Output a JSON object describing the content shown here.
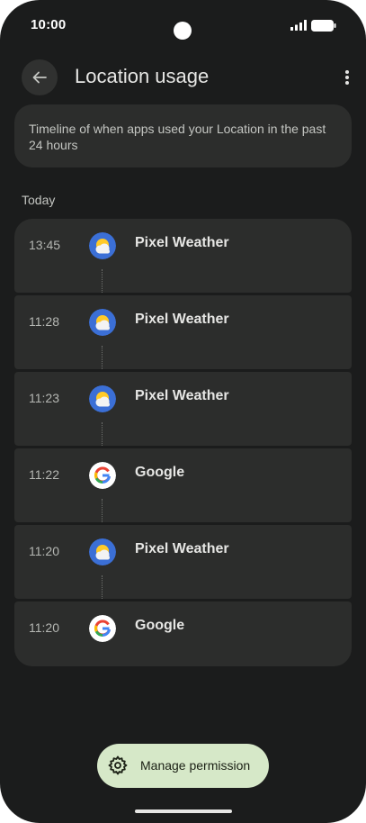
{
  "status_bar": {
    "time": "10:00"
  },
  "app_bar": {
    "title": "Location usage"
  },
  "info": {
    "text": "Timeline of when apps used your Location in the past 24 hours"
  },
  "section": {
    "label": "Today"
  },
  "entries": [
    {
      "time": "13:45",
      "app": "Pixel Weather",
      "icon": "pixel-weather-icon"
    },
    {
      "time": "11:28",
      "app": "Pixel Weather",
      "icon": "pixel-weather-icon"
    },
    {
      "time": "11:23",
      "app": "Pixel Weather",
      "icon": "pixel-weather-icon"
    },
    {
      "time": "11:22",
      "app": "Google",
      "icon": "google-icon"
    },
    {
      "time": "11:20",
      "app": "Pixel Weather",
      "icon": "pixel-weather-icon"
    },
    {
      "time": "11:20",
      "app": "Google",
      "icon": "google-icon"
    }
  ],
  "fab": {
    "label": "Manage permission",
    "icon": "gear-icon"
  },
  "colors": {
    "background": "#1b1c1c",
    "card": "#2c2d2c",
    "fab": "#d6e8c8"
  }
}
